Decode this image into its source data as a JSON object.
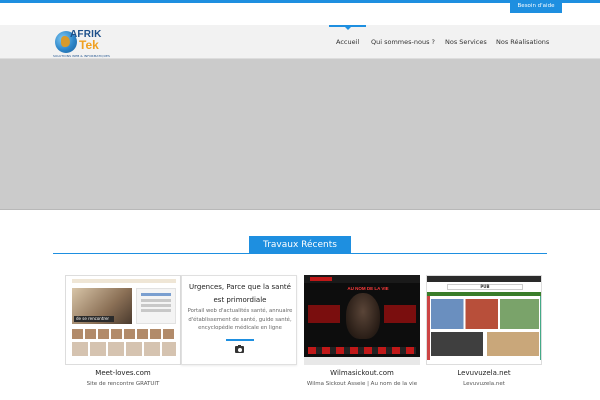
{
  "topbar": {
    "help_label": "Besoin d'aide"
  },
  "logo": {
    "name_part1": "AFRIK",
    "name_part2": "Tek",
    "tagline": "SOLUTIONS WEB & INFORMATIQUES"
  },
  "nav": {
    "items": [
      {
        "label": "Accueil",
        "active": true
      },
      {
        "label": "Qui sommes-nous ?",
        "active": false
      },
      {
        "label": "Nos Services",
        "active": false
      },
      {
        "label": "Nos Réalisations",
        "active": false
      }
    ]
  },
  "section": {
    "title": "Travaux Récents"
  },
  "works": [
    {
      "title": "Meet-loves.com",
      "subtitle": "Site de rencontre GRATUIT",
      "thumb_overlay": "de se rencontrer"
    },
    {
      "heading": "Urgences, Parce que la santé est primordiale",
      "description": "Portail web d'actualités santé, annuaire d'établissement de santé, guide santé, encyclopédie médicale en ligne",
      "icon": "camera-icon"
    },
    {
      "title": "Wilmasickout.com",
      "subtitle": "Wilma Sickout Asseie | Au nom de la vie",
      "thumb_banner": "AU NOM DE LA VIE"
    },
    {
      "title": "Levuvuzela.net",
      "subtitle": "Levuvuzela.net",
      "thumb_pub": "PUB"
    }
  ],
  "colors": {
    "accent": "#1e8fe0",
    "header_bg": "#f2f2f2",
    "hero_bg": "#cbcbcb"
  }
}
